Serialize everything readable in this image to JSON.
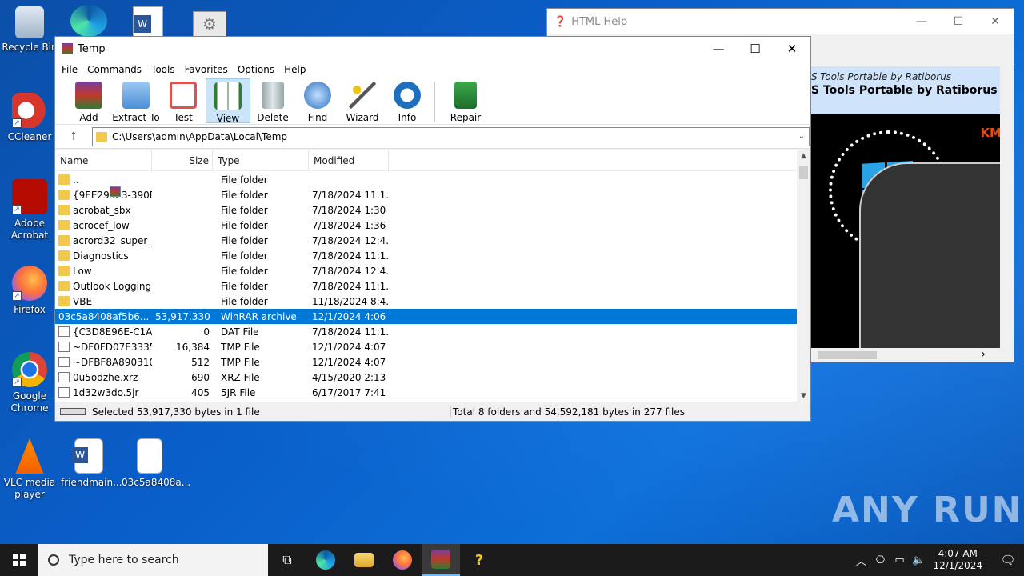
{
  "desktop": {
    "icons": [
      {
        "label": "Recycle Bin"
      },
      {
        "label": "CCleaner"
      },
      {
        "label": "Adobe Acrobat"
      },
      {
        "label": "Firefox"
      },
      {
        "label": "Google Chrome"
      },
      {
        "label": "VLC media player"
      },
      {
        "label": "friendmain..."
      },
      {
        "label": "03c5a8408a..."
      }
    ],
    "watermark": "ANY RUN"
  },
  "help_window": {
    "title": "HTML Help",
    "header_line1": "S Tools Portable by Ratiborus",
    "header_line2": "S Tools Portable by Ratiborus",
    "km_label": "KM"
  },
  "winrar": {
    "title": "Temp",
    "menu": [
      "File",
      "Commands",
      "Tools",
      "Favorites",
      "Options",
      "Help"
    ],
    "toolbar": [
      {
        "label": "Add",
        "color": "#c0392b"
      },
      {
        "label": "Extract To",
        "color": "#4a8fd8"
      },
      {
        "label": "Test",
        "color": "#d9534f"
      },
      {
        "label": "View",
        "color": "#2e7d32"
      },
      {
        "label": "Delete",
        "color": "#7f8c8d"
      },
      {
        "label": "Find",
        "color": "#2f6fc0"
      },
      {
        "label": "Wizard",
        "color": "#8e44ad"
      },
      {
        "label": "Info",
        "color": "#1f6fbf"
      },
      {
        "label": "Repair",
        "color": "#2e8b3e"
      }
    ],
    "address": "C:\\Users\\admin\\AppData\\Local\\Temp",
    "columns": [
      "Name",
      "Size",
      "Type",
      "Modified"
    ],
    "rows": [
      {
        "name": "..",
        "size": "",
        "type": "File folder",
        "modified": "",
        "icon": "folder"
      },
      {
        "name": "{9EE293E3-390D...",
        "size": "",
        "type": "File folder",
        "modified": "7/18/2024 11:1...",
        "icon": "folder"
      },
      {
        "name": "acrobat_sbx",
        "size": "",
        "type": "File folder",
        "modified": "7/18/2024 1:30 ...",
        "icon": "folder"
      },
      {
        "name": "acrocef_low",
        "size": "",
        "type": "File folder",
        "modified": "7/18/2024 1:36 ...",
        "icon": "folder"
      },
      {
        "name": "acrord32_super_...",
        "size": "",
        "type": "File folder",
        "modified": "7/18/2024 12:4...",
        "icon": "folder"
      },
      {
        "name": "Diagnostics",
        "size": "",
        "type": "File folder",
        "modified": "7/18/2024 11:1...",
        "icon": "folder"
      },
      {
        "name": "Low",
        "size": "",
        "type": "File folder",
        "modified": "7/18/2024 12:4...",
        "icon": "folder"
      },
      {
        "name": "Outlook Logging",
        "size": "",
        "type": "File folder",
        "modified": "7/18/2024 11:1...",
        "icon": "folder"
      },
      {
        "name": "VBE",
        "size": "",
        "type": "File folder",
        "modified": "11/18/2024 8:4...",
        "icon": "folder"
      },
      {
        "name": "03c5a8408af5b6...",
        "size": "53,917,330",
        "type": "WinRAR archive",
        "modified": "12/1/2024 4:06 ...",
        "icon": "rar",
        "selected": true
      },
      {
        "name": "{C3D8E96E-C1A...",
        "size": "0",
        "type": "DAT File",
        "modified": "7/18/2024 11:1...",
        "icon": "file"
      },
      {
        "name": "~DF0FD07E3335...",
        "size": "16,384",
        "type": "TMP File",
        "modified": "12/1/2024 4:07 ...",
        "icon": "file"
      },
      {
        "name": "~DFBF8A890310...",
        "size": "512",
        "type": "TMP File",
        "modified": "12/1/2024 4:07 ...",
        "icon": "file"
      },
      {
        "name": "0u5odzhe.xrz",
        "size": "690",
        "type": "XRZ File",
        "modified": "4/15/2020 2:13 ...",
        "icon": "file"
      },
      {
        "name": "1d32w3do.5jr",
        "size": "405",
        "type": "5JR File",
        "modified": "6/17/2017 7:41 ...",
        "icon": "file"
      }
    ],
    "status_left": "Selected 53,917,330 bytes in 1 file",
    "status_right": "Total 8 folders and 54,592,181 bytes in 277 files"
  },
  "taskbar": {
    "search_placeholder": "Type here to search",
    "time": "4:07 AM",
    "date": "12/1/2024"
  }
}
